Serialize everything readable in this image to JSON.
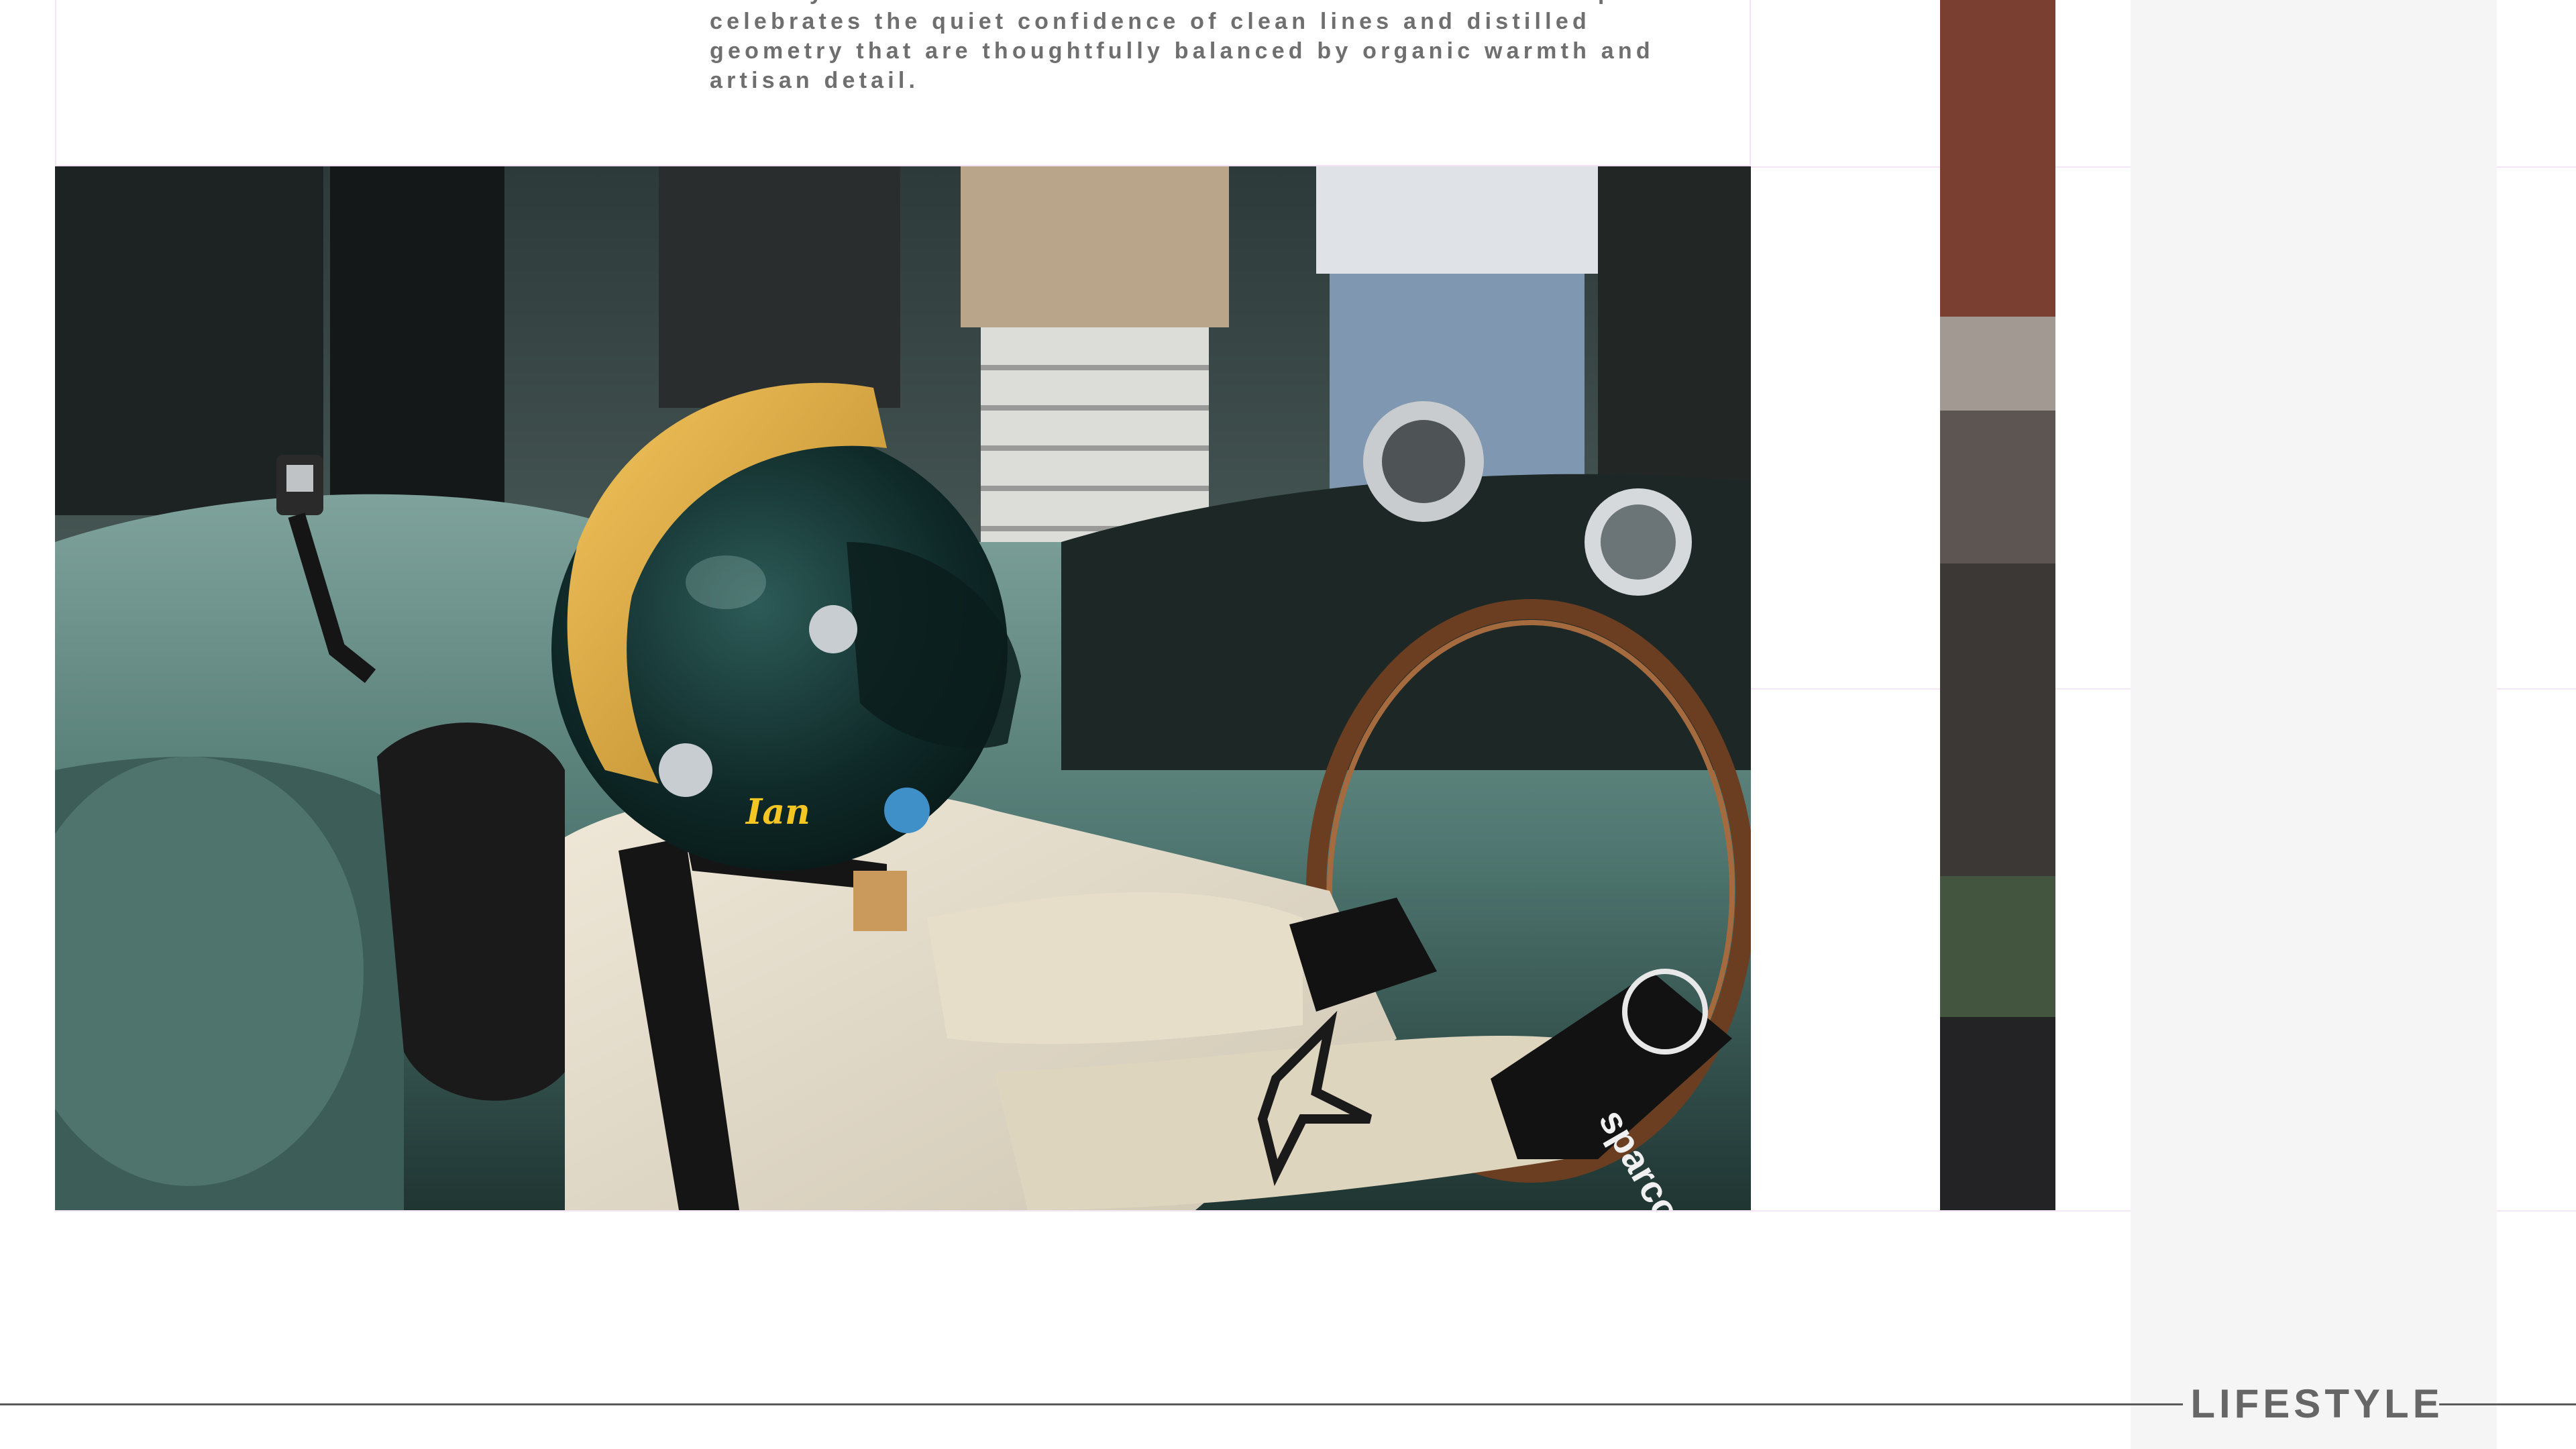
{
  "body_text": "sensory and emotional moment within the home. This concept celebrates the quiet confidence of clean lines and distilled geometry that are thoughtfully balanced by organic warmth and artisan detail.",
  "photo": {
    "helmet_name": "Ian",
    "glove_brand": "sparco",
    "image_semantic": "racing-driver-photo"
  },
  "palette": [
    {
      "name": "rust",
      "color": "#7b3f31"
    },
    {
      "name": "taupe",
      "color": "#a29a92"
    },
    {
      "name": "warm-grey",
      "color": "#5c5551"
    },
    {
      "name": "charcoal",
      "color": "#3b3835"
    },
    {
      "name": "forest-green",
      "color": "#43553f"
    },
    {
      "name": "ink",
      "color": "#232225"
    }
  ],
  "footer": {
    "label": "LIFESTYLE"
  },
  "colors": {
    "side_panel": "#f5f5f6",
    "text": "#6f6f6f",
    "guide": "#f5e6f5"
  }
}
